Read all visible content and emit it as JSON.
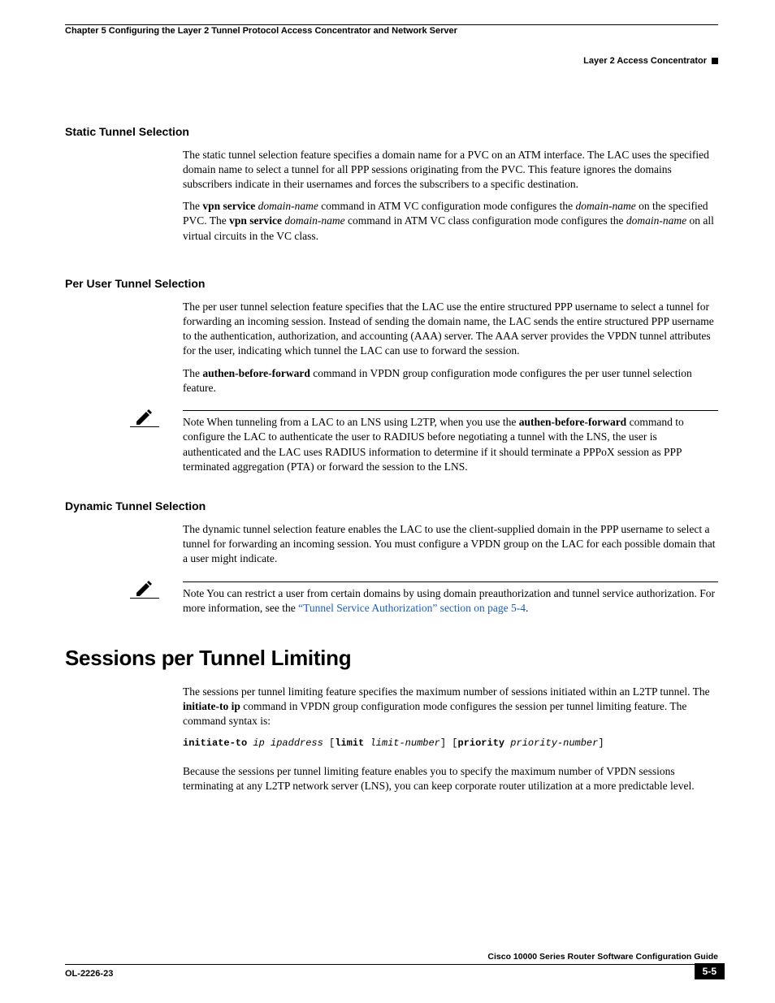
{
  "header": {
    "chapter": "Chapter 5    Configuring the Layer 2 Tunnel Protocol Access Concentrator and Network Server",
    "section": "Layer 2 Access Concentrator"
  },
  "sections": {
    "static": {
      "heading": "Static Tunnel Selection",
      "p1_a": "The static tunnel selection feature specifies a domain name for a PVC on an ATM interface. The LAC uses the specified domain name to select a tunnel for all PPP sessions originating from the PVC. This feature ignores the domains subscribers indicate in their usernames and forces the subscribers to a specific destination.",
      "p2_pre": "The ",
      "p2_b1": "vpn service",
      "p2_mid1": " ",
      "p2_i1": "domain-name",
      "p2_mid2": " command in ATM VC configuration mode configures the ",
      "p2_i2": "domain-name",
      "p2_mid3": " on the specified PVC. The ",
      "p2_b2": "vpn service",
      "p2_mid4": " ",
      "p2_i3": "domain-name",
      "p2_mid5": " command in ATM VC class configuration mode configures the ",
      "p2_i4": "domain-name",
      "p2_end": " on all virtual circuits in the VC class."
    },
    "peruser": {
      "heading": "Per User Tunnel Selection",
      "p1": "The per user tunnel selection feature specifies that the LAC use the entire structured PPP username to select a tunnel for forwarding an incoming session. Instead of sending the domain name, the LAC sends the entire structured PPP username to the authentication, authorization, and accounting (AAA) server. The AAA server provides the VPDN tunnel attributes for the user, indicating which tunnel the LAC can use to forward the session.",
      "p2_pre": "The ",
      "p2_b1": "authen-before-forward",
      "p2_end": " command in VPDN group configuration mode configures the per user tunnel selection feature.",
      "note_label": "Note",
      "note_pre": "When tunneling from a LAC to an LNS using L2TP, when you use the ",
      "note_b1": "authen-before-forward",
      "note_end": " command to configure the LAC to authenticate the user to RADIUS before negotiating a tunnel with the LNS, the user is authenticated and the LAC uses RADIUS information to determine if it should terminate a PPPoX session as PPP terminated aggregation (PTA) or forward the session to the LNS."
    },
    "dynamic": {
      "heading": "Dynamic Tunnel Selection",
      "p1": "The dynamic tunnel selection feature enables the LAC to use the client-supplied domain in the PPP username to select a tunnel for forwarding an incoming session. You must configure a VPDN group on the LAC for each possible domain that a user might indicate.",
      "note_label": "Note",
      "note_pre": "You can restrict a user from certain domains by using domain preauthorization and tunnel service authorization. For more information, see the ",
      "note_link": "“Tunnel Service Authorization” section on page 5-4",
      "note_end": "."
    },
    "sessions": {
      "heading": "Sessions per Tunnel Limiting",
      "p1_pre": "The sessions per tunnel limiting feature specifies the maximum number of sessions initiated within an L2TP tunnel. The ",
      "p1_b1": "initiate-to ip",
      "p1_end": " command in VPDN group configuration mode configures the session per tunnel limiting feature. The command syntax is:",
      "code": {
        "c1": "initiate-to",
        "c2": " ip ipaddress ",
        "c3": "[",
        "c4": "limit",
        "c5": " limit-number",
        "c6": "] [",
        "c7": "priority",
        "c8": " priority-number",
        "c9": "]"
      },
      "p2": "Because the sessions per tunnel limiting feature enables you to specify the maximum number of VPDN sessions terminating at any L2TP network server (LNS), you can keep corporate router utilization at a more predictable level."
    }
  },
  "footer": {
    "guide": "Cisco 10000 Series Router Software Configuration Guide",
    "docnum": "OL-2226-23",
    "pagenum": "5-5"
  }
}
